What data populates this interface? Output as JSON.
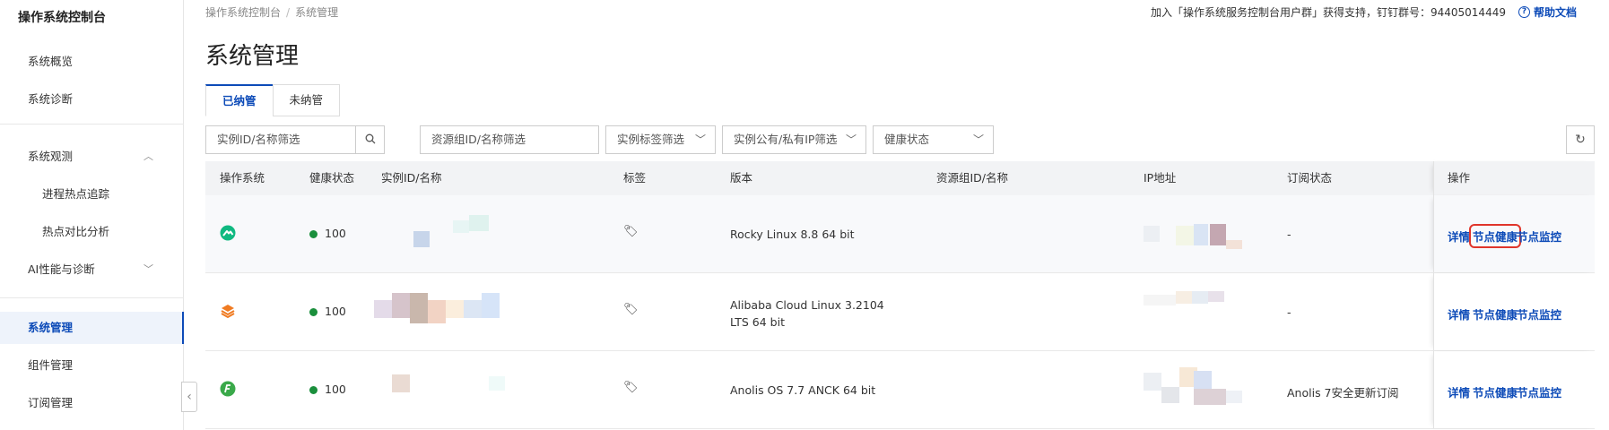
{
  "sidebar": {
    "title": "操作系统控制台",
    "items": [
      {
        "label": "系统概览"
      },
      {
        "label": "系统诊断"
      },
      {
        "label": "系统观测"
      },
      {
        "label": "进程热点追踪"
      },
      {
        "label": "热点对比分析"
      },
      {
        "label": "AI性能与诊断"
      },
      {
        "label": "系统管理"
      },
      {
        "label": "组件管理"
      },
      {
        "label": "订阅管理"
      }
    ]
  },
  "breadcrumb": {
    "root": "操作系统控制台",
    "separator": "/",
    "current": "系统管理"
  },
  "support": {
    "text": "加入「操作系统服务控制台用户群」获得支持，钉钉群号：94405014449",
    "help_label": "帮助文档",
    "help_icon": "?"
  },
  "page_title": "系统管理",
  "tabs": [
    {
      "label": "已纳管"
    },
    {
      "label": "未纳管"
    }
  ],
  "filters": {
    "instance_placeholder": "实例ID/名称筛选",
    "resource_group_placeholder": "资源组ID/名称筛选",
    "tag_filter": "实例标签筛选",
    "ip_filter": "实例公有/私有IP筛选",
    "health_filter": "健康状态"
  },
  "table": {
    "headers": {
      "os": "操作系统",
      "health": "健康状态",
      "instance": "实例ID/名称",
      "tags": "标签",
      "version": "版本",
      "resource_group": "资源组ID/名称",
      "ip": "IP地址",
      "subscription": "订阅状态",
      "actions": "操作"
    },
    "rows": [
      {
        "health": "100",
        "version": "Rocky Linux  8.8 64 bit",
        "subscription": "-",
        "os_color": "#10b981"
      },
      {
        "health": "100",
        "version": "Alibaba Cloud Linux  3.2104 LTS 64 bit",
        "subscription": "-",
        "os_color": "#f07b22"
      },
      {
        "health": "100",
        "version": "Anolis OS  7.7 ANCK 64 bit",
        "subscription": "Anolis 7安全更新订阅",
        "os_color": "#3aa94a"
      }
    ],
    "actions": {
      "detail": "详情",
      "node_health": "节点健康",
      "node_monitor": "节点监控"
    }
  },
  "icons": {
    "search": "search-icon",
    "chevron": "chevron-down-icon",
    "refresh": "refresh-icon",
    "tag": "tag-icon"
  }
}
